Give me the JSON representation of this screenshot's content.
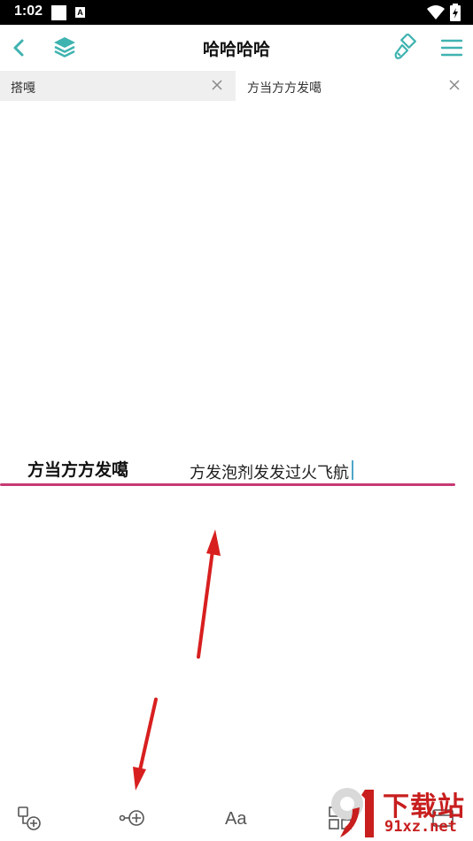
{
  "status_bar": {
    "time": "1:02",
    "notif_icon_letter": "A"
  },
  "app_bar": {
    "title": "哈哈哈哈",
    "icons": [
      "chevron-left-icon",
      "layers-icon",
      "paint-brush-icon",
      "menu-icon"
    ]
  },
  "tabs": [
    {
      "label": "搭嘎",
      "active": false
    },
    {
      "label": "方当方方发噶",
      "active": true
    }
  ],
  "mindmap": {
    "root": "方当方方发噶",
    "child": "方发泡剂发发过火飞航",
    "branch_color": "#c73a72"
  },
  "bottom_toolbar": {
    "items": [
      "add-node-icon",
      "add-branch-icon",
      "text-style-icon",
      "layout-icon",
      "more-icon"
    ],
    "text_style_label": "Aa"
  },
  "watermark": {
    "cn": "下载站",
    "en": "91xz.net",
    "color": "#c81e1e"
  },
  "colors": {
    "accent": "#3fb3b0",
    "annotation_arrow": "#d81f1f"
  }
}
